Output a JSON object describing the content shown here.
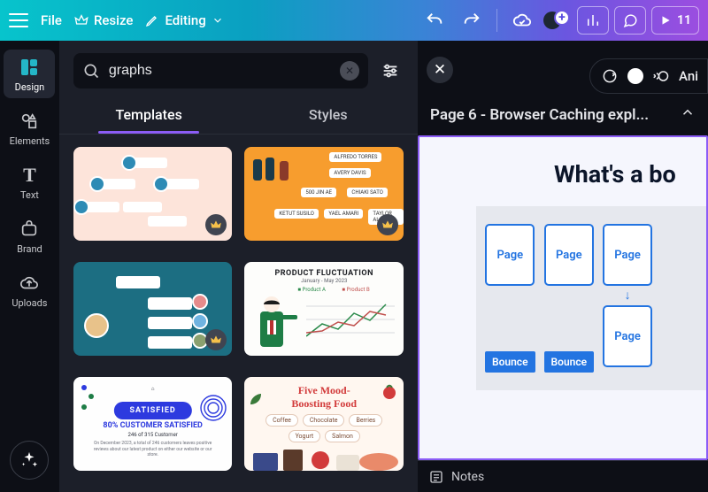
{
  "topbar": {
    "file": "File",
    "resize": "Resize",
    "editing": "Editing",
    "present_number": "11"
  },
  "leftnav": {
    "design": "Design",
    "elements": "Elements",
    "text": "Text",
    "brand": "Brand",
    "uploads": "Uploads"
  },
  "search": {
    "value": "graphs"
  },
  "tabs": {
    "templates": "Templates",
    "styles": "Styles"
  },
  "templates": {
    "t2": {
      "n1": "ALFREDO TORRES",
      "n2": "AVERY DAVIS",
      "n3": "500 JIN AE",
      "n4": "CHIAKI SATO",
      "n5": "KETUT SUSILO",
      "n6": "YAEL AMARI",
      "n7": "TAYLOR ALON"
    },
    "t4": {
      "title": "PRODUCT FLUCTUATION",
      "sub": "January - May 2023",
      "legendA": "Product A",
      "legendB": "Product B"
    },
    "t5": {
      "pill": "SATISFIED",
      "line1": "80% CUSTOMER SATISFIED",
      "line2": "246 of 315 Customer",
      "line3": "On December 2023, a total of 246 customers leaves positive reviews about our latest product on either our website or our store."
    },
    "t6": {
      "title1": "Five Mood-",
      "title2": "Boosting Food",
      "p1": "Coffee",
      "p2": "Chocolate",
      "p3": "Berries",
      "p4": "Yogurt",
      "p5": "Salmon"
    }
  },
  "float_tools": {
    "animate": "Ani"
  },
  "page_header": "Page 6 - Browser Caching expl...",
  "slide": {
    "heading": "What's a bo",
    "page": "Page",
    "bounce": "Bounce"
  },
  "bottombar": {
    "notes": "Notes"
  }
}
